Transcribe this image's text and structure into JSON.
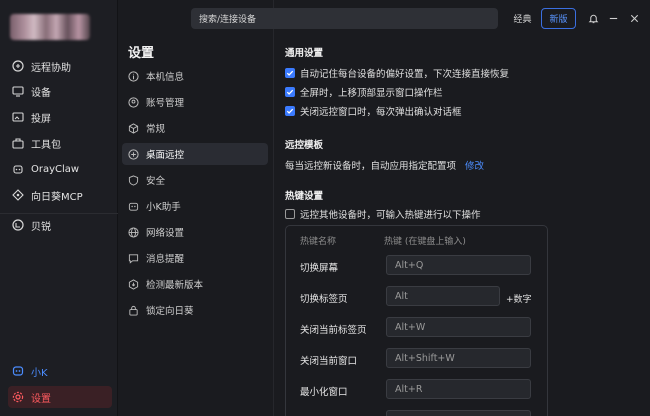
{
  "app": {
    "search_placeholder": "搜索/连接设备",
    "mode_classic": "经典",
    "mode_new": "新版"
  },
  "nav": {
    "items": [
      {
        "label": "远程协助",
        "icon": "remote-assist-icon"
      },
      {
        "label": "设备",
        "icon": "monitor-icon"
      },
      {
        "label": "投屏",
        "icon": "cast-screen-icon"
      },
      {
        "label": "工具包",
        "icon": "toolbox-icon"
      },
      {
        "label": "OrayClaw",
        "icon": "claw-icon"
      },
      {
        "label": "向日葵MCP",
        "icon": "mcp-icon"
      },
      {
        "label": "贝锐",
        "icon": "oray-logo-icon"
      }
    ],
    "bottom": [
      {
        "label": "小K",
        "icon": "assistant-icon"
      },
      {
        "label": "设置",
        "icon": "gear-icon"
      }
    ]
  },
  "settings": {
    "title": "设置",
    "items": [
      {
        "label": "本机信息",
        "icon": "info-icon"
      },
      {
        "label": "账号管理",
        "icon": "account-icon"
      },
      {
        "label": "常规",
        "icon": "cube-icon"
      },
      {
        "label": "桌面远控",
        "icon": "desktop-remote-icon"
      },
      {
        "label": "安全",
        "icon": "shield-icon"
      },
      {
        "label": "小K助手",
        "icon": "k-assistant-icon"
      },
      {
        "label": "网络设置",
        "icon": "globe-icon"
      },
      {
        "label": "消息提醒",
        "icon": "message-icon"
      },
      {
        "label": "检测最新版本",
        "icon": "update-icon"
      },
      {
        "label": "锁定向日葵",
        "icon": "lock-icon"
      }
    ]
  },
  "main": {
    "general": {
      "title": "通用设置",
      "options": [
        {
          "label": "自动记住每台设备的偏好设置，下次连接直接恢复",
          "checked": true
        },
        {
          "label": "全屏时，上移顶部显示窗口操作栏",
          "checked": true
        },
        {
          "label": "关闭远控窗口时，每次弹出确认对话框",
          "checked": true
        }
      ]
    },
    "template": {
      "title": "远控模板",
      "desc": "每当远控新设备时，自动应用指定配置项",
      "link": "修改"
    },
    "hotkeys": {
      "title": "热键设置",
      "enable_label": "远控其他设备时，可输入热键进行以下操作",
      "enable_checked": false,
      "col_name": "热键名称",
      "col_key": "热键 (在键盘上输入)",
      "rows": [
        {
          "name": "切换屏幕",
          "key": "Alt+Q"
        },
        {
          "name": "切换标签页",
          "key": "Alt",
          "extra": "+数字"
        },
        {
          "name": "关闭当前标签页",
          "key": "Alt+W"
        },
        {
          "name": "关闭当前窗口",
          "key": "Alt+Shift+W"
        },
        {
          "name": "最小化窗口",
          "key": "Alt+R"
        }
      ]
    }
  },
  "colors": {
    "accent_red": "#ff5a5f",
    "accent_blue": "#4c8dff",
    "checkbox_blue": "#3b7bff"
  }
}
